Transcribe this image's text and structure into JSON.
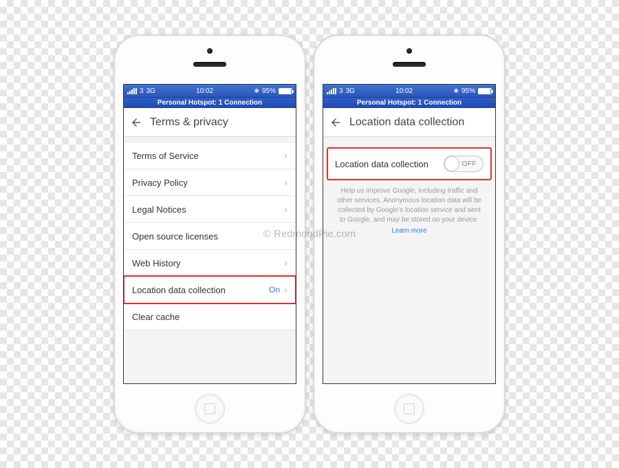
{
  "watermark": "© RedmondPie.com",
  "status": {
    "carrier": "3",
    "network": "3G",
    "time": "10:02",
    "battery_pct": "95%",
    "bluetooth_glyph": "✱"
  },
  "hotspot": "Personal Hotspot: 1 Connection",
  "left": {
    "header_title": "Terms & privacy",
    "rows": [
      {
        "label": "Terms of Service",
        "chevron": true
      },
      {
        "label": "Privacy Policy",
        "chevron": true
      },
      {
        "label": "Legal Notices",
        "chevron": true
      },
      {
        "label": "Open source licenses",
        "chevron": false
      },
      {
        "label": "Web History",
        "chevron": true
      },
      {
        "label": "Location data collection",
        "value": "On",
        "chevron": true,
        "highlight": true
      },
      {
        "label": "Clear cache",
        "chevron": false
      }
    ]
  },
  "right": {
    "header_title": "Location data collection",
    "toggle_label": "Location data collection",
    "toggle_state": "OFF",
    "help_text": "Help us improve Google, including traffic and other services. Anonymous location data will be collected by Google's location service and sent to Google, and may be stored on your device.",
    "learn_more": "Learn more"
  }
}
